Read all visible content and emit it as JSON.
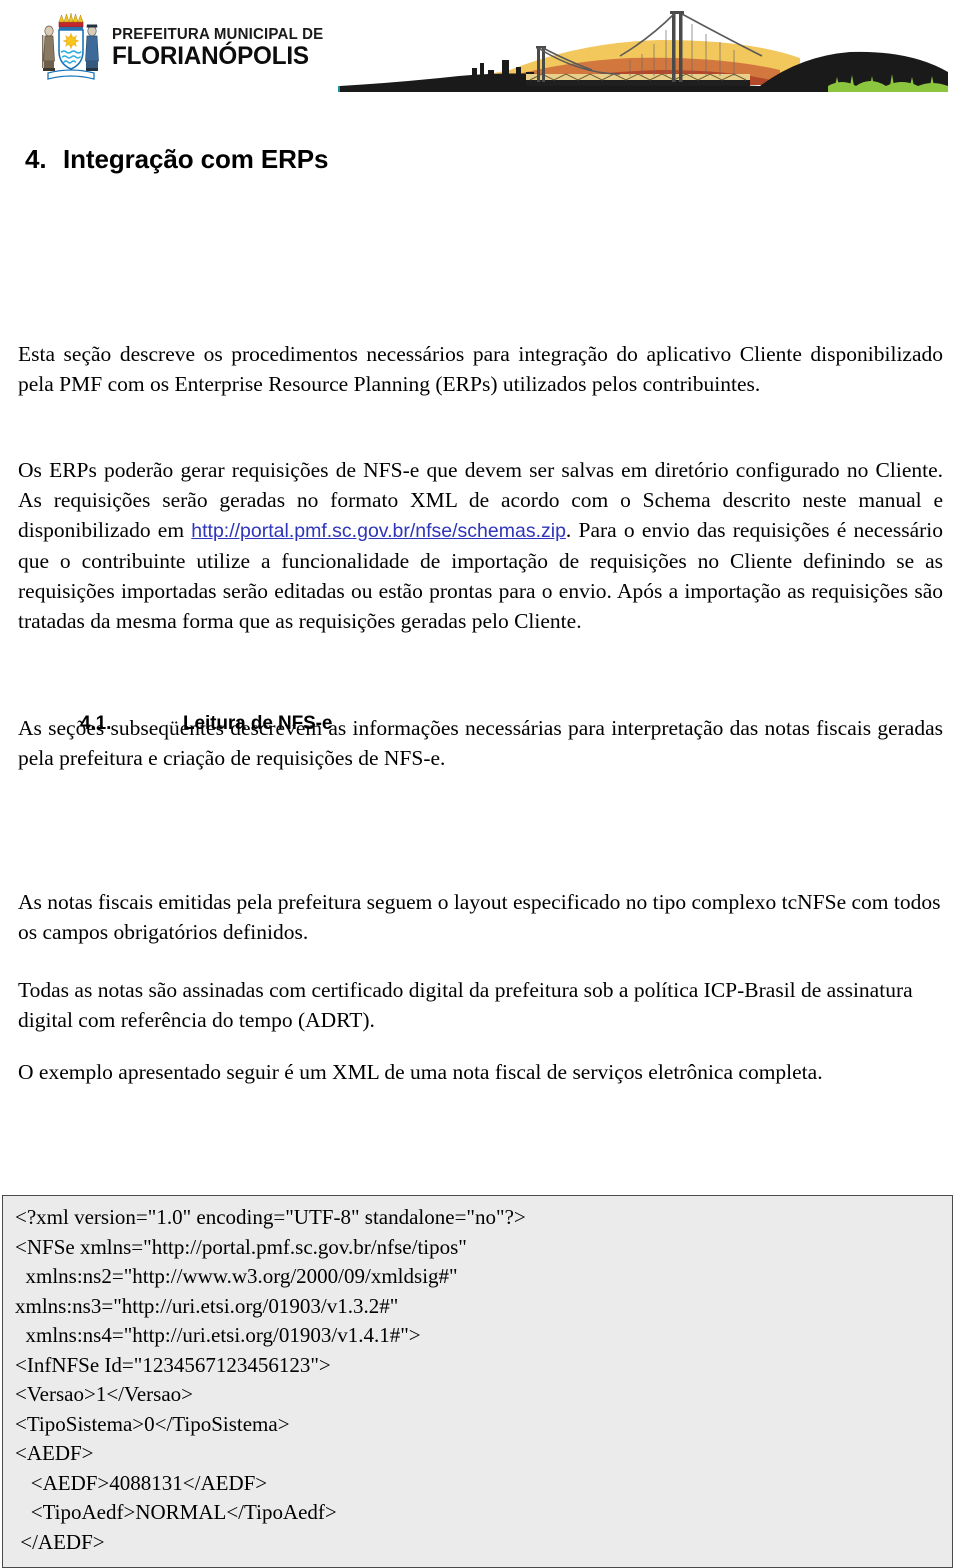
{
  "header": {
    "logo": {
      "coat_of_arms_alt": "Brasão de Florianópolis",
      "line1": "PREFEITURA MUNICIPAL DE",
      "line2": "FLORIANÓPOLIS"
    },
    "banner_alt": "Ponte Hercílio Luz ao pôr do sol"
  },
  "colors": {
    "link": "#2f35b8",
    "code_background": "#ebebeb",
    "code_border": "#4a4a4a",
    "shield_blue": "#29abe2",
    "sun_yellow": "#f7c51e",
    "crown_red": "#c1272d",
    "sky_yellow": "#f2c75c",
    "sky_orange": "#d2703a",
    "water_teal": "#1b8fa3",
    "grass_green": "#8cc63f",
    "silhouette_black": "#1a1a1a"
  },
  "section": {
    "number": "4.",
    "title": "Integração com ERPs"
  },
  "subsection": {
    "number": "4.1.",
    "title": "Leitura de NFS-e"
  },
  "paragraphs": {
    "p1": "Esta seção descreve os procedimentos necessários para integração do aplicativo Cliente disponibilizado pela PMF com os Enterprise Resource Planning (ERPs) utilizados pelos contribuintes.",
    "p2_before_link": "Os ERPs poderão gerar requisições de NFS-e que devem ser salvas em diretório configurado no Cliente. As requisições serão geradas no formato XML de acordo com o Schema descrito neste manual e disponibilizado em ",
    "p2_link": "http://portal.pmf.sc.gov.br/nfse/schemas.zip",
    "p2_after_link": ". Para o envio das requisições é necessário que o contribuinte utilize a funcionalidade de importação de requisições no Cliente definindo se as requisições importadas serão editadas ou estão prontas para o envio. Após a importação as requisições são tratadas da mesma forma que as requisições geradas pelo Cliente.",
    "p3": "As seções subseqüentes descrevem as informações necessárias para interpretação das notas fiscais geradas pela prefeitura e criação de requisições de NFS-e.",
    "p4": "As notas fiscais emitidas pela prefeitura seguem o layout especificado no tipo complexo tcNFSe com todos os campos obrigatórios definidos.",
    "p5": "Todas as notas são assinadas com certificado digital da prefeitura sob a política ICP-Brasil de assinatura digital com referência do tempo (ADRT).",
    "p6": "O exemplo apresentado seguir é um XML de uma nota fiscal de serviços eletrônica completa."
  },
  "code_sample": {
    "language": "xml",
    "lines": [
      "<?xml version=\"1.0\" encoding=\"UTF-8\" standalone=\"no\"?>",
      "<NFSe xmlns=\"http://portal.pmf.sc.gov.br/nfse/tipos\"",
      "  xmlns:ns2=\"http://www.w3.org/2000/09/xmldsig#\"",
      "xmlns:ns3=\"http://uri.etsi.org/01903/v1.3.2#\"",
      "  xmlns:ns4=\"http://uri.etsi.org/01903/v1.4.1#\">",
      "<InfNFSe Id=\"1234567123456123\">",
      "<Versao>1</Versao>",
      "<TipoSistema>0</TipoSistema>",
      "<AEDF>",
      "   <AEDF>4088131</AEDF>",
      "   <TipoAedf>NORMAL</TipoAedf>",
      " </AEDF>"
    ],
    "text": "<?xml version=\"1.0\" encoding=\"UTF-8\" standalone=\"no\"?>\n<NFSe xmlns=\"http://portal.pmf.sc.gov.br/nfse/tipos\"\n  xmlns:ns2=\"http://www.w3.org/2000/09/xmldsig#\"\nxmlns:ns3=\"http://uri.etsi.org/01903/v1.3.2#\"\n  xmlns:ns4=\"http://uri.etsi.org/01903/v1.4.1#\">\n<InfNFSe Id=\"1234567123456123\">\n<Versao>1</Versao>\n<TipoSistema>0</TipoSistema>\n<AEDF>\n   <AEDF>4088131</AEDF>\n   <TipoAedf>NORMAL</TipoAedf>\n </AEDF>"
  }
}
